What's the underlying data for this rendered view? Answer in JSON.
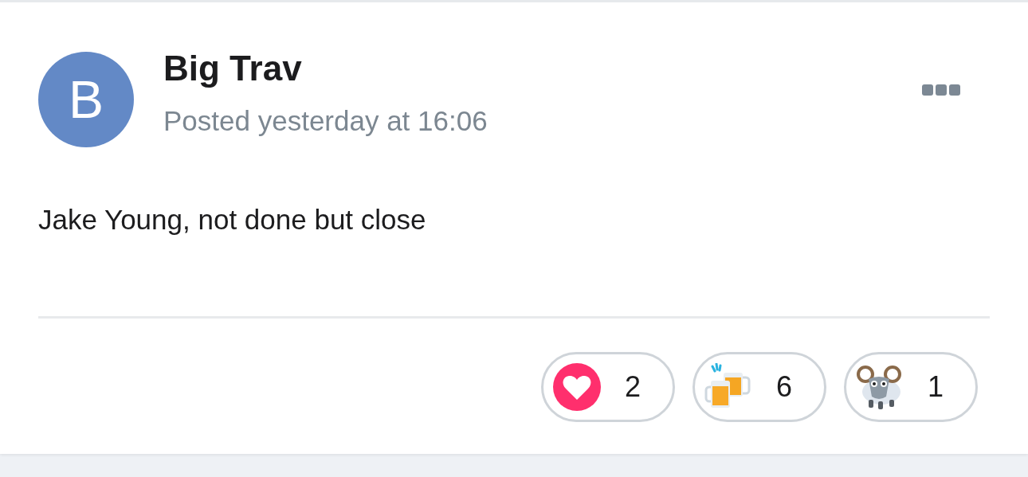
{
  "post": {
    "author": {
      "initial": "B",
      "name": "Big Trav"
    },
    "timestamp": "Posted yesterday at 16:06",
    "body": "Jake Young, not done but close"
  },
  "reactions": [
    {
      "kind": "heart",
      "count": "2"
    },
    {
      "kind": "beers",
      "count": "6"
    },
    {
      "kind": "ram",
      "count": "1"
    }
  ]
}
